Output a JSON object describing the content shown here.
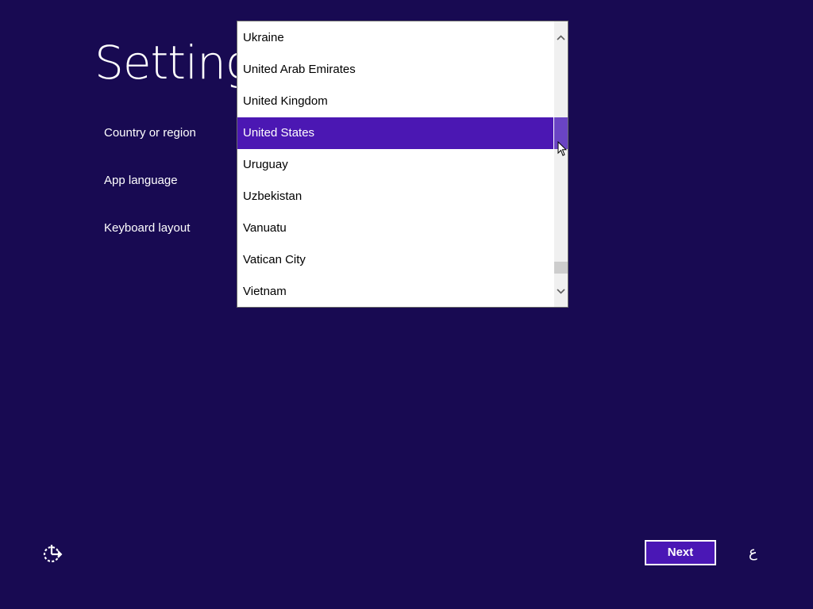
{
  "page": {
    "title": "Settings"
  },
  "fields": {
    "country_label": "Country or region",
    "app_language_label": "App language",
    "keyboard_label": "Keyboard layout"
  },
  "dropdown": {
    "options": [
      "Ukraine",
      "United Arab Emirates",
      "United Kingdom",
      "United States",
      "Uruguay",
      "Uzbekistan",
      "Vanuatu",
      "Vatican City",
      "Vietnam"
    ],
    "selected": "United States",
    "selected_color": "#4b17b3"
  },
  "footer": {
    "next_label": "Next",
    "input_indicator": "ع",
    "ease_of_access_icon": "ease-of-access-icon"
  },
  "colors": {
    "background": "#180a52",
    "accent": "#4a17b5"
  }
}
